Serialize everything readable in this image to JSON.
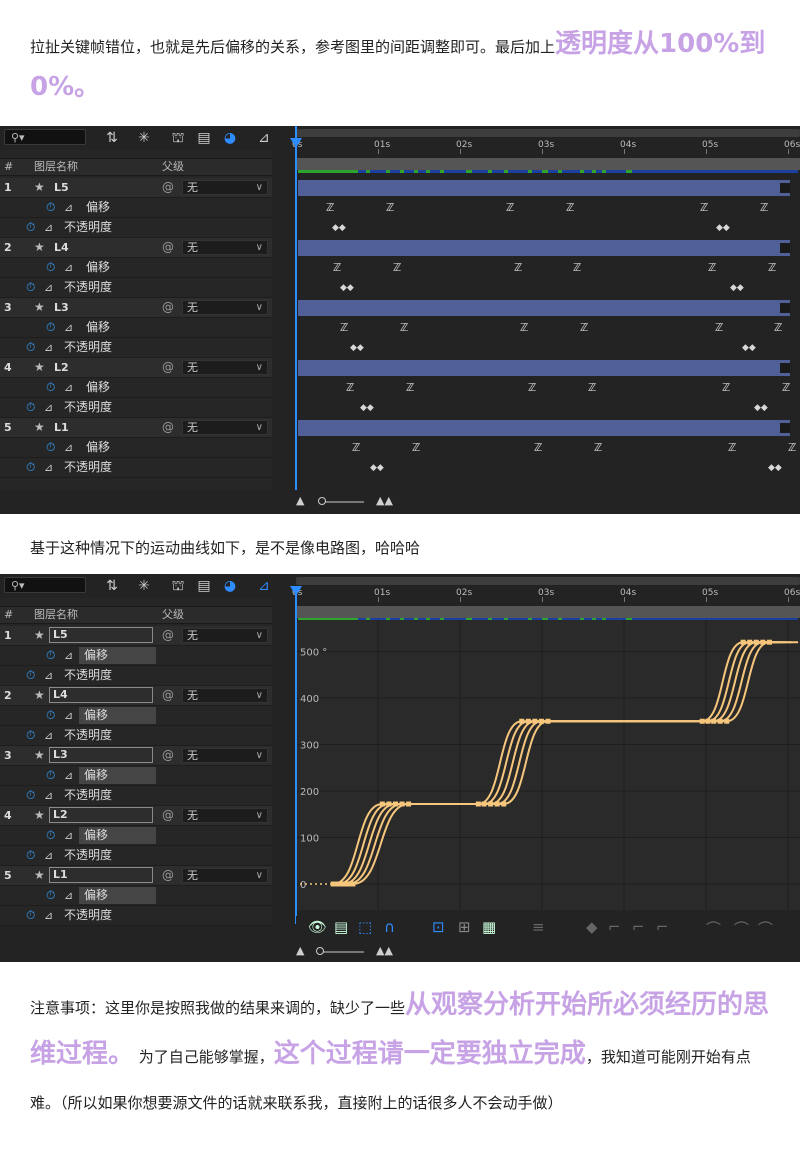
{
  "intro": {
    "text": "拉扯关键帧错位，也就是先后偏移的关系，参考图里的间距调整即可。最后加上",
    "highlight": "透明度从100%到0%。"
  },
  "caption": "基于这种情况下的运动曲线如下，是不是像电路图，哈哈哈",
  "note": {
    "p1": "注意事项：这里你是按照我做的结果来调的，缺少了一些",
    "h1": "从观察分析开始所必须经历的思维过程。",
    "p2": " 为了自己能够掌握，",
    "h2": "这个过程请一定要独立完成",
    "p3": "，我知道可能刚开始有点难。（所以如果你想要源文件的话就来联系我，直接附上的话很多人不会动手做）"
  },
  "ae": {
    "search_placeholder": "",
    "search_icon": "magnifier-icon",
    "col_num": "#",
    "col_name": "图层名称",
    "col_parent": "父级",
    "parent_value": "无",
    "prop_offset": "偏移",
    "prop_opacity": "不透明度",
    "layers": [
      {
        "num": "1",
        "name": "L5"
      },
      {
        "num": "2",
        "name": "L4"
      },
      {
        "num": "3",
        "name": "L3"
      },
      {
        "num": "4",
        "name": "L2"
      },
      {
        "num": "5",
        "name": "L1"
      }
    ],
    "ruler_ticks": [
      "0s",
      "01s",
      "02s",
      "03s",
      "04s",
      "05s",
      "06s"
    ],
    "accent_color": "#2d8cff",
    "layer_bar_color": "#52609a",
    "curve_color": "#f6c67c"
  },
  "graph": {
    "y_ticks": [
      "500 °",
      "400",
      "300",
      "200",
      "100",
      "0"
    ]
  },
  "chart_data": {
    "type": "line",
    "title": "",
    "xlabel": "",
    "ylabel": "",
    "ylim": [
      0,
      520
    ],
    "x_unit": "s",
    "series": [
      {
        "x": [
          0.38,
          0.98,
          2.15,
          2.68,
          4.88,
          5.38
        ],
        "values": [
          0,
          172,
          172,
          350,
          350,
          520
        ]
      },
      {
        "x": [
          0.44,
          1.06,
          2.22,
          2.76,
          4.95,
          5.46
        ],
        "values": [
          0,
          172,
          172,
          350,
          350,
          520
        ]
      },
      {
        "x": [
          0.5,
          1.14,
          2.3,
          2.84,
          5.02,
          5.54
        ],
        "values": [
          0,
          172,
          172,
          350,
          350,
          520
        ]
      },
      {
        "x": [
          0.56,
          1.22,
          2.38,
          2.92,
          5.1,
          5.62
        ],
        "values": [
          0,
          172,
          172,
          350,
          350,
          520
        ]
      },
      {
        "x": [
          0.62,
          1.3,
          2.46,
          3.0,
          5.18,
          5.7
        ],
        "values": [
          0,
          172,
          172,
          350,
          350,
          520
        ]
      }
    ]
  }
}
